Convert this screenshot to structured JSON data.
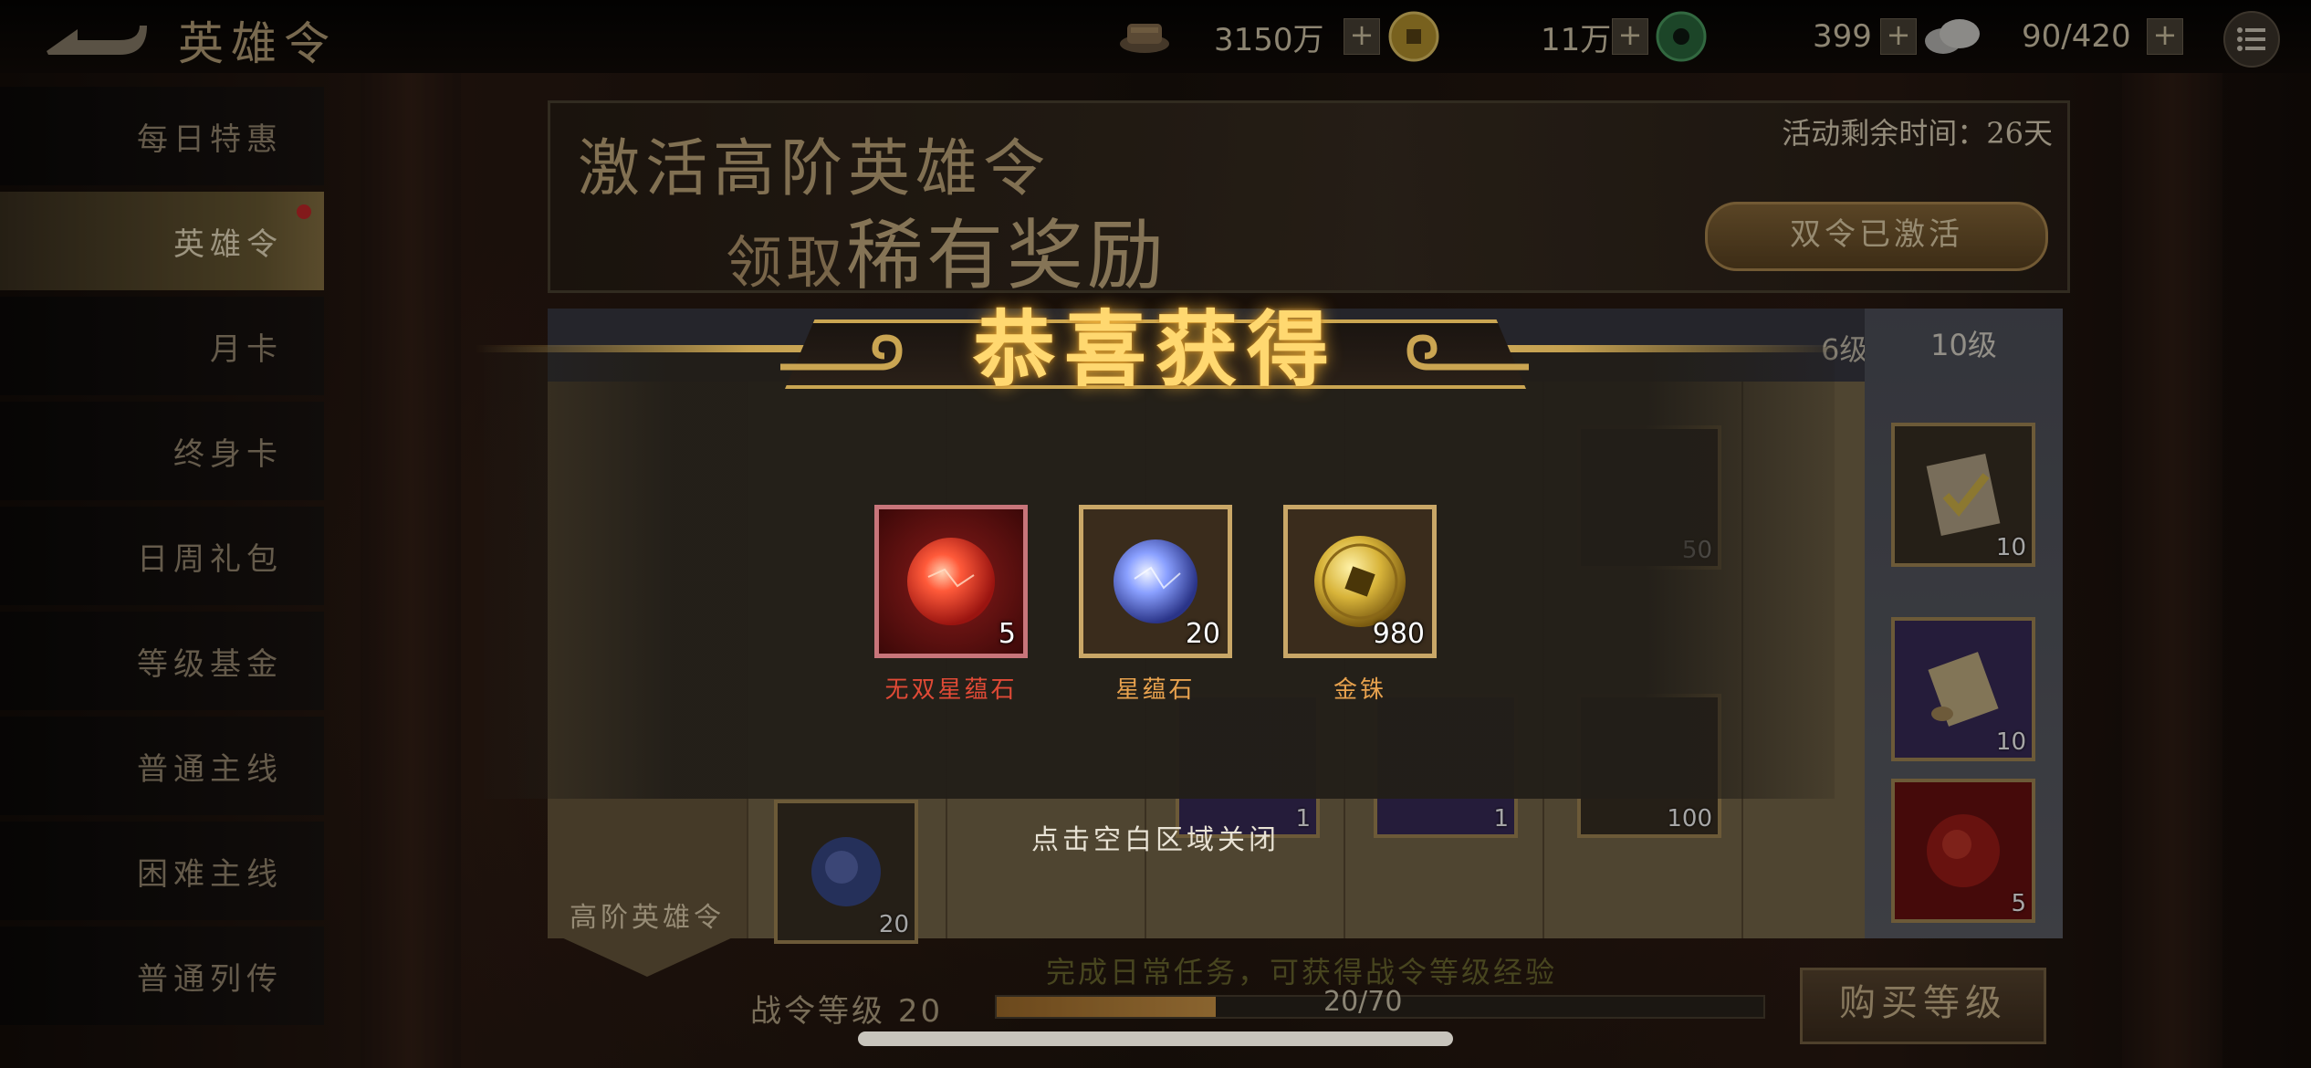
{
  "header": {
    "title": "英雄令",
    "resources": [
      {
        "icon": "silver-ingot-icon",
        "value": "3150万"
      },
      {
        "icon": "gold-coin-icon",
        "value": "11万"
      },
      {
        "icon": "jade-disc-icon",
        "value": "399"
      },
      {
        "icon": "stamina-cloud-icon",
        "value": "90/420"
      }
    ]
  },
  "sidebar": {
    "items": [
      {
        "label": "每日特惠"
      },
      {
        "label": "英雄令",
        "active": true,
        "badge": true
      },
      {
        "label": "月卡"
      },
      {
        "label": "终身卡"
      },
      {
        "label": "日周礼包"
      },
      {
        "label": "等级基金"
      },
      {
        "label": "普通主线"
      },
      {
        "label": "困难主线"
      },
      {
        "label": "普通列传"
      }
    ]
  },
  "banner": {
    "line1": "激活高阶英雄令",
    "line2_prefix": "领取",
    "line2_emphasis": "稀有奖励",
    "timer": "活动剩余时间：26天",
    "button": "双令已激活"
  },
  "table": {
    "level6": "6级",
    "level10": "10级",
    "tier_label": "高阶英雄令",
    "slot_counts": [
      "10",
      "10",
      "5",
      "20",
      "1",
      "1",
      "100",
      "50"
    ]
  },
  "footer": {
    "hint": "完成日常任务，可获得战令等级经验",
    "level_label": "战令等级",
    "level_value": "20",
    "progress_text": "20/70",
    "progress_fraction": 0.2857,
    "buy_button": "购买等级"
  },
  "modal": {
    "title": "恭喜获得",
    "rewards": [
      {
        "name": "无双星蕴石",
        "count": "5",
        "icon": "red-star-orb-icon",
        "rarity": "red"
      },
      {
        "name": "星蕴石",
        "count": "20",
        "icon": "blue-star-orb-icon",
        "rarity": "orange"
      },
      {
        "name": "金铢",
        "count": "980",
        "icon": "gold-coin-icon",
        "rarity": "orange"
      }
    ],
    "close_hint": "点击空白区域关闭"
  },
  "colors": {
    "accent_gold": "#ffd870",
    "rarity_red": "#e04a36",
    "rarity_orange": "#e8a24e"
  }
}
